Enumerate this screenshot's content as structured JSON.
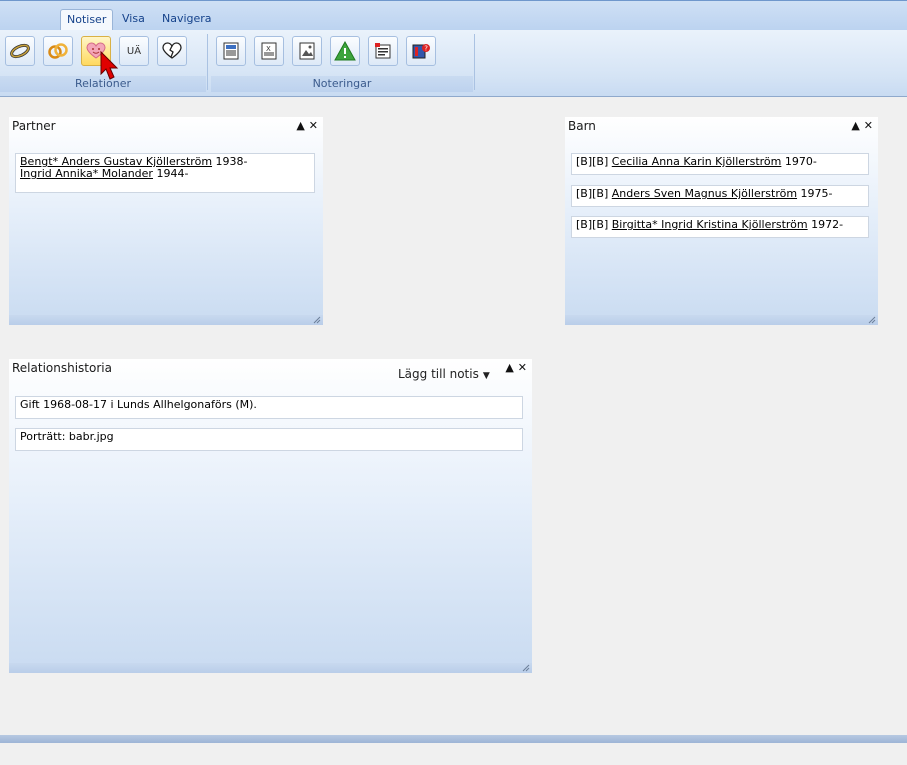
{
  "ribbon": {
    "tabs": [
      {
        "label": "Notiser",
        "active": true
      },
      {
        "label": "Visa",
        "active": false
      },
      {
        "label": "Navigera",
        "active": false
      }
    ],
    "groups": {
      "relationer": {
        "caption": "Relationer",
        "buttons": [
          {
            "name": "ring-icon"
          },
          {
            "name": "wedding-rings-icon"
          },
          {
            "name": "heart-face-icon",
            "hover": true
          },
          {
            "name": "ua-icon",
            "text": "UÄ"
          },
          {
            "name": "broken-heart-icon"
          }
        ]
      },
      "noteringar": {
        "caption": "Noteringar",
        "buttons": [
          {
            "name": "text-note-icon"
          },
          {
            "name": "document-note-icon"
          },
          {
            "name": "image-note-icon"
          },
          {
            "name": "warning-icon"
          },
          {
            "name": "source-note-icon"
          },
          {
            "name": "book-note-icon"
          }
        ]
      }
    }
  },
  "panels": {
    "partner": {
      "title": "Partner",
      "lines": [
        {
          "link": "Bengt* Anders Gustav Kjöllerström",
          "suffix": " 1938-"
        },
        {
          "link": "Ingrid Annika* Molander",
          "suffix": " 1944-"
        }
      ]
    },
    "barn": {
      "title": "Barn",
      "items": [
        {
          "prefix": "[B][B] ",
          "link": "Cecilia Anna Karin Kjöllerström",
          "suffix": " 1970-"
        },
        {
          "prefix": "[B][B] ",
          "link": "Anders Sven Magnus Kjöllerström",
          "suffix": " 1975-"
        },
        {
          "prefix": "[B][B] ",
          "link": "Birgitta* Ingrid Kristina Kjöllerström",
          "suffix": " 1972-"
        }
      ]
    },
    "history": {
      "title": "Relationshistoria",
      "add_note_label": "Lägg till notis",
      "items": [
        "Gift 1968-08-17 i Lunds Allhelgonaförs (M).",
        "Porträtt: babr.jpg"
      ]
    }
  }
}
